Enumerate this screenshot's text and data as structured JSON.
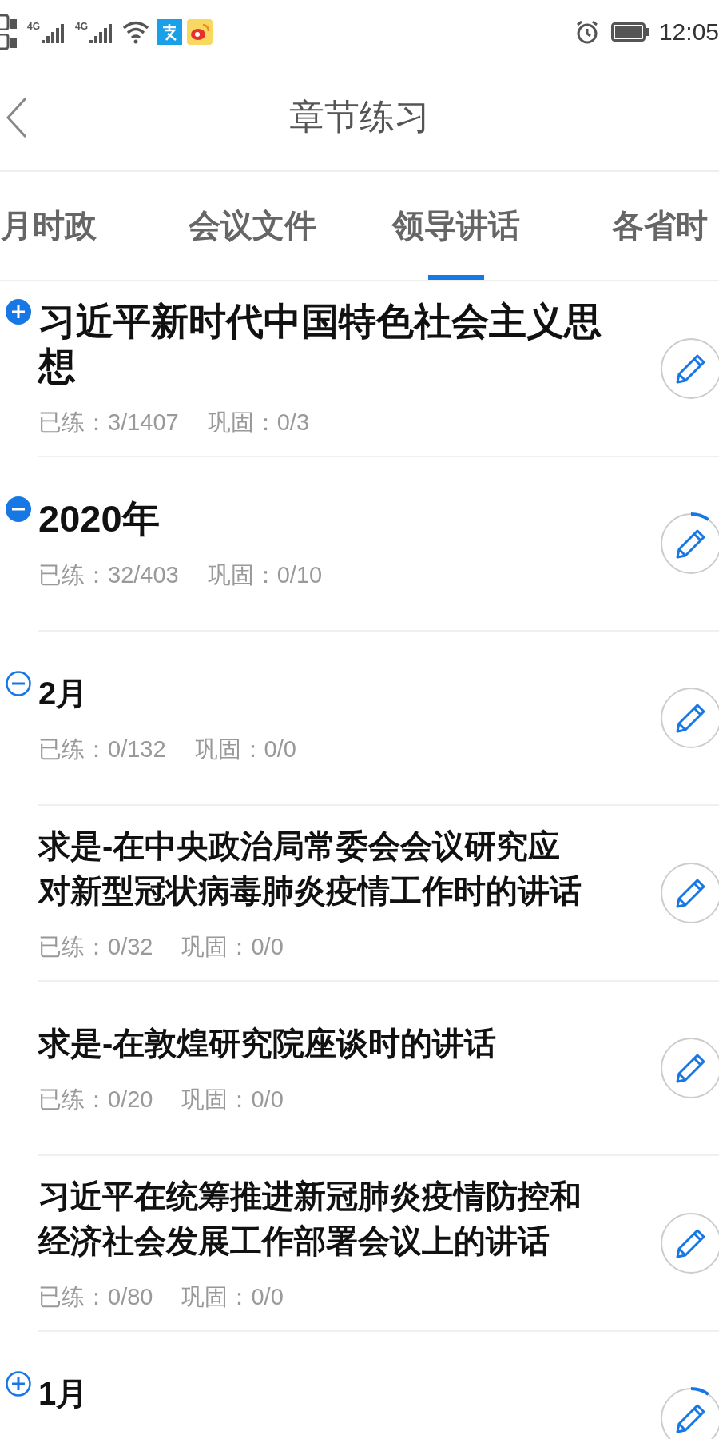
{
  "status_bar": {
    "time": "12:05",
    "signal_labels": [
      "4G",
      "4G"
    ]
  },
  "header": {
    "title": "章节练习"
  },
  "tabs": [
    {
      "label": "月时政",
      "selected": false
    },
    {
      "label": "会议文件",
      "selected": false
    },
    {
      "label": "领导讲话",
      "selected": true
    },
    {
      "label": "各省时",
      "selected": false
    }
  ],
  "chapters": [
    {
      "kind": "group",
      "title": "习近平新时代中国特色社会主义思想",
      "practiced": "已练：3/1407",
      "consolidated": "巩固：0/3",
      "expanded": false,
      "started": false
    },
    {
      "kind": "group",
      "title": "2020年",
      "practiced": "已练：32/403",
      "consolidated": "巩固：0/10",
      "expanded": true,
      "started": true,
      "children": [
        {
          "kind": "group",
          "title": "2月",
          "practiced": "已练：0/132",
          "consolidated": "巩固：0/0",
          "expanded": true,
          "started": false,
          "children": [
            {
              "kind": "leaf",
              "title": "求是-在中央政治局常委会会议研究应对新型冠状病毒肺炎疫情工作时的讲话",
              "practiced": "已练：0/32",
              "consolidated": "巩固：0/0",
              "started": false
            },
            {
              "kind": "leaf",
              "title": "求是-在敦煌研究院座谈时的讲话",
              "practiced": "已练：0/20",
              "consolidated": "巩固：0/0",
              "started": false
            },
            {
              "kind": "leaf",
              "title": "习近平在统筹推进新冠肺炎疫情防控和经济社会发展工作部署会议上的讲话",
              "practiced": "已练：0/80",
              "consolidated": "巩固：0/0",
              "started": false
            }
          ]
        },
        {
          "kind": "group",
          "title": "1月",
          "expanded": false,
          "started": true
        }
      ]
    }
  ]
}
